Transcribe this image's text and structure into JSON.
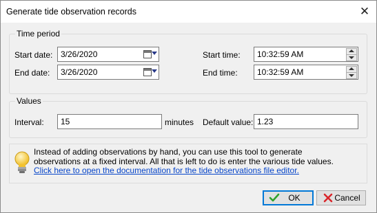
{
  "window": {
    "title": "Generate tide observation records",
    "close_glyph": "✕"
  },
  "time_period": {
    "legend": "Time period",
    "start_date_label": "Start date:",
    "start_date_value": "3/26/2020",
    "end_date_label": "End date:",
    "end_date_value": "3/26/2020",
    "start_time_label": "Start time:",
    "start_time_value": "10:32:59 AM",
    "end_time_label": "End time:",
    "end_time_value": "10:32:59 AM"
  },
  "values": {
    "legend": "Values",
    "interval_label": "Interval:",
    "interval_value": "15",
    "interval_unit": "minutes",
    "default_label": "Default value:",
    "default_value": "1.23"
  },
  "info": {
    "line1": "Instead of adding observations by hand, you can use this tool to generate",
    "line2": "observations at a fixed interval. All that is left to do is enter the various tide values.",
    "link": "Click here to open the documentation for the tide observations file editor.",
    "icon": "lightbulb-icon"
  },
  "buttons": {
    "ok": "OK",
    "cancel": "Cancel"
  },
  "colors": {
    "link": "#0645c9",
    "ok_border": "#0078d7",
    "check": "#2ea32e",
    "cross": "#d9262b"
  }
}
